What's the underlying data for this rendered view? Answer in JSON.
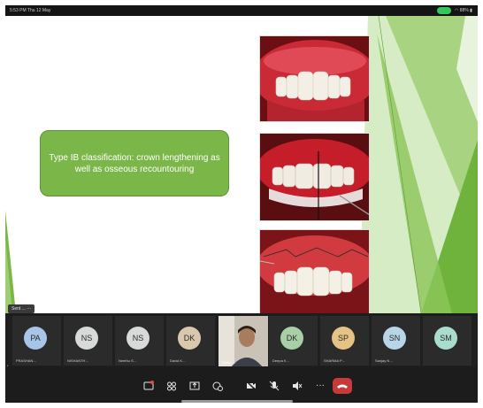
{
  "status_bar": {
    "time": "5:53 PM  Thu 12 May",
    "battery": "88%"
  },
  "slide": {
    "classification_text": "Type IB classification: crown lengthening as well as osseous recountouring",
    "presenter_tag": "Sent ...  ···"
  },
  "participants": [
    {
      "initials": "PA",
      "name": "PRASHAN…",
      "color": "#a8c4e8"
    },
    {
      "initials": "NS",
      "name": "NISHANTH…",
      "color": "#d7dad8"
    },
    {
      "initials": "NS",
      "name": "Neethu S…",
      "color": "#d7dad8"
    },
    {
      "initials": "DK",
      "name": "David K…",
      "color": "#d9c8ae"
    },
    {
      "initials": "",
      "name": "Shibu …",
      "video": true
    },
    {
      "initials": "DK",
      "name": "Deepa K…",
      "color": "#a9cfa6"
    },
    {
      "initials": "SP",
      "name": "SHARMA P…",
      "color": "#e5c384"
    },
    {
      "initials": "SN",
      "name": "Sanjay N…",
      "color": "#b7d6e8"
    },
    {
      "initials": "SM",
      "name": "",
      "color": "#a9dccd"
    }
  ],
  "toolbar": {
    "buttons": [
      "screen-share-icon",
      "participants-icon",
      "share-content-icon",
      "reactions-icon",
      "video-off-icon",
      "mic-off-icon",
      "speaker-mute-icon",
      "more-icon",
      "end-call-icon"
    ]
  }
}
